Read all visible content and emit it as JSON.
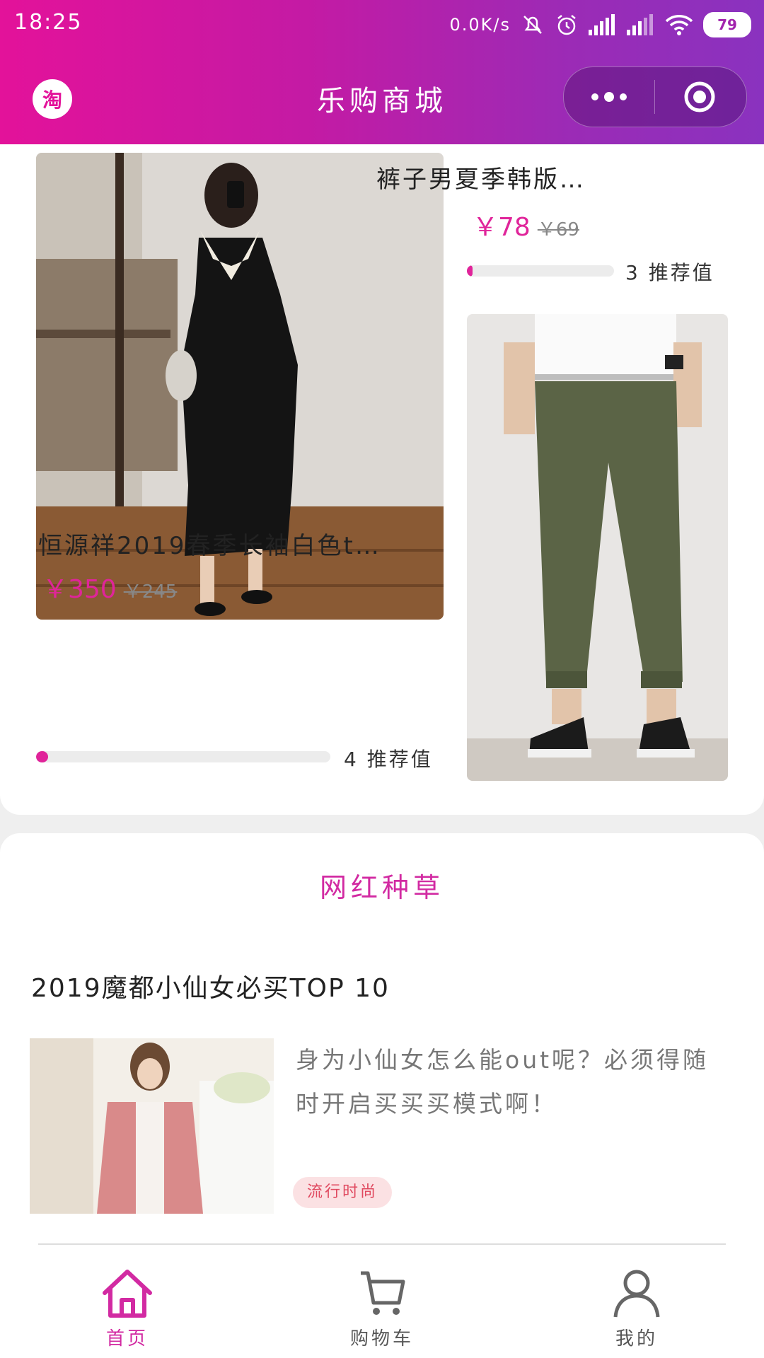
{
  "status_bar": {
    "time": "18:25",
    "network_speed": "0.0K/s",
    "battery": "79"
  },
  "header": {
    "logo_text": "淘",
    "title": "乐购商城"
  },
  "products": [
    {
      "name": "恒源祥2019春季长袖白色t…",
      "price": "￥350",
      "old_price": "￥245",
      "recommend": "4 推荐值",
      "recommend_level": 0.04
    },
    {
      "name": "裤子男夏季韩版…",
      "price": "￥78",
      "old_price": "￥69",
      "recommend": "3 推荐值",
      "recommend_level": 0.03
    }
  ],
  "section": {
    "title": "网红种草",
    "article": {
      "title": "2019魔都小仙女必买TOP 10",
      "description": "身为小仙女怎么能out呢？必须得随时开启买买买模式啊！",
      "tag": "流行时尚"
    }
  },
  "tabbar": {
    "items": [
      {
        "label": "首页",
        "icon": "home-icon",
        "active": true
      },
      {
        "label": "购物车",
        "icon": "cart-icon",
        "active": false
      },
      {
        "label": "我的",
        "icon": "user-icon",
        "active": false
      }
    ]
  },
  "colors": {
    "accent": "#e0249a",
    "header_start": "#e3129a",
    "header_end": "#8a32bf"
  }
}
